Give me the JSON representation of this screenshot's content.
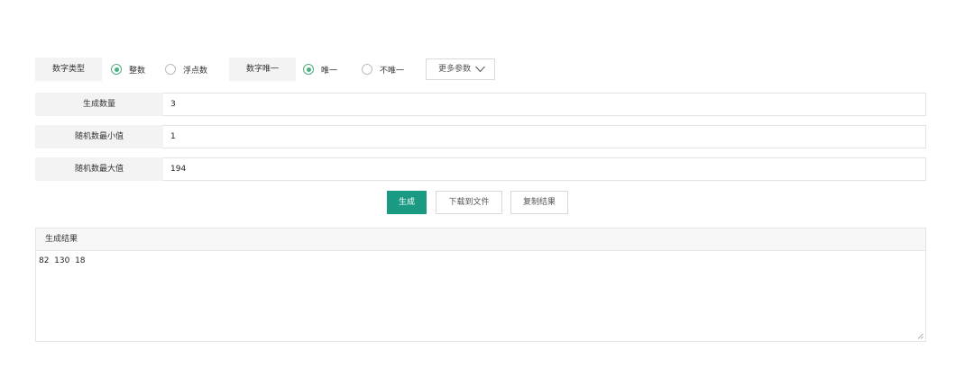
{
  "options": {
    "number_type_label": "数字类型",
    "type_integer": "整数",
    "type_float": "浮点数",
    "unique_label": "数字唯一",
    "unique_yes": "唯一",
    "unique_no": "不唯一",
    "more_params": "更多参数"
  },
  "fields": {
    "count_label": "生成数量",
    "count_value": "3",
    "min_label": "随机数最小值",
    "min_value": "1",
    "max_label": "随机数最大值",
    "max_value": "194"
  },
  "actions": {
    "generate": "生成",
    "download": "下载到文件",
    "copy": "复制结果"
  },
  "result": {
    "header": "生成结果",
    "text": "82  130  18"
  },
  "state": {
    "number_type_selected": "整数",
    "unique_selected": "唯一"
  },
  "colors": {
    "accent": "#1a9a83",
    "radio_checked": "#4caf80",
    "label_bg": "#f3f3f3"
  },
  "icons": {
    "more_params": "chevron-down-icon",
    "textarea": "resize-handle-icon"
  }
}
